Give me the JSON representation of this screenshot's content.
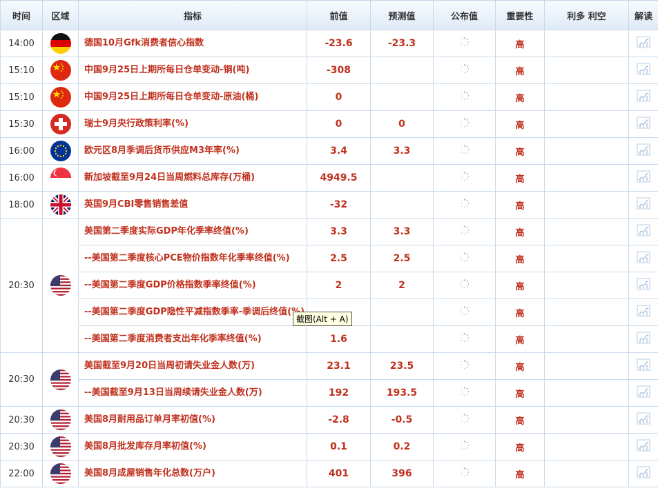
{
  "headers": {
    "time": "时间",
    "region": "区域",
    "indicator": "指标",
    "previous": "前值",
    "forecast": "预测值",
    "actual": "公布值",
    "importance": "重要性",
    "impact": "利多 利空",
    "analysis": "解读"
  },
  "rows": [
    {
      "time": "14:00",
      "flag": "germany-flag-icon",
      "indicator": "德国10月Gfk消费者信心指数",
      "previous": "-23.6",
      "forecast": "-23.3",
      "importance": "高"
    },
    {
      "time": "15:10",
      "flag": "china-flag-icon",
      "indicator": "中国9月25日上期所每日仓单变动-铜(吨)",
      "previous": "-308",
      "forecast": "",
      "importance": "高"
    },
    {
      "time": "15:10",
      "flag": "china-flag-icon",
      "indicator": "中国9月25日上期所每日仓单变动-原油(桶)",
      "previous": "0",
      "forecast": "",
      "importance": "高"
    },
    {
      "time": "15:30",
      "flag": "switzerland-flag-icon",
      "indicator": "瑞士9月央行政策利率(%)",
      "previous": "0",
      "forecast": "0",
      "importance": "高"
    },
    {
      "time": "16:00",
      "flag": "eu-flag-icon",
      "indicator": "欧元区8月季调后货币供应M3年率(%)",
      "previous": "3.4",
      "forecast": "3.3",
      "importance": "高"
    },
    {
      "time": "16:00",
      "flag": "singapore-flag-icon",
      "indicator": "新加坡截至9月24日当周燃料总库存(万桶)",
      "previous": "4949.5",
      "forecast": "",
      "importance": "高"
    },
    {
      "time": "18:00",
      "flag": "uk-flag-icon",
      "indicator": "英国9月CBI零售销售差值",
      "previous": "-32",
      "forecast": "",
      "importance": "高"
    }
  ],
  "group_us_gdp": {
    "time": "20:30",
    "flag": "us-flag-icon",
    "items": [
      {
        "indicator": "美国第二季度实际GDP年化季率终值(%)",
        "previous": "3.3",
        "forecast": "3.3",
        "importance": "高"
      },
      {
        "indicator": "--美国第二季度核心PCE物价指数年化季率终值(%)",
        "previous": "2.5",
        "forecast": "2.5",
        "importance": "高"
      },
      {
        "indicator": "--美国第二季度GDP价格指数季率终值(%)",
        "previous": "2",
        "forecast": "2",
        "importance": "高"
      },
      {
        "indicator": "--美国第二季度GDP隐性平减指数季率-季调后终值(%)",
        "previous": "",
        "forecast": "",
        "importance": "高"
      },
      {
        "indicator": "--美国第二季度消费者支出年化季率终值(%)",
        "previous": "1.6",
        "forecast": "",
        "importance": "高"
      }
    ]
  },
  "group_us_jobless": {
    "time": "20:30",
    "flag": "us-flag-icon",
    "items": [
      {
        "indicator": "美国截至9月20日当周初请失业金人数(万)",
        "previous": "23.1",
        "forecast": "23.5",
        "importance": "高"
      },
      {
        "indicator": "--美国截至9月13日当周续请失业金人数(万)",
        "previous": "192",
        "forecast": "193.5",
        "importance": "高"
      }
    ]
  },
  "tail_rows": [
    {
      "time": "20:30",
      "flag": "us-flag-icon",
      "indicator": "美国8月耐用品订单月率初值(%)",
      "previous": "-2.8",
      "forecast": "-0.5",
      "importance": "高"
    },
    {
      "time": "20:30",
      "flag": "us-flag-icon",
      "indicator": "美国8月批发库存月率初值(%)",
      "previous": "0.1",
      "forecast": "0.2",
      "importance": "高"
    },
    {
      "time": "22:00",
      "flag": "us-flag-icon",
      "indicator": "美国8月成屋销售年化总数(万户)",
      "previous": "401",
      "forecast": "396",
      "importance": "高"
    }
  ],
  "tooltip": "截图(Alt + A)",
  "colors": {
    "accent": "#c0301d",
    "border": "#c9d9ea",
    "header_bg": "#dfeaf6"
  }
}
